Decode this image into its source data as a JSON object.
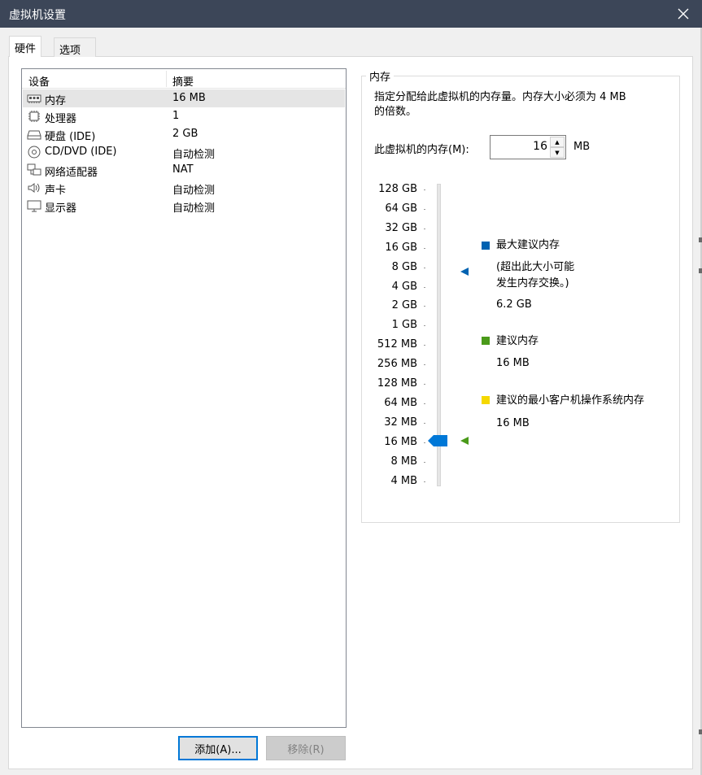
{
  "window": {
    "title": "虚拟机设置"
  },
  "tabs": [
    {
      "label": "硬件"
    },
    {
      "label": "选项"
    }
  ],
  "device_list": {
    "columns": [
      "设备",
      "摘要"
    ],
    "rows": [
      {
        "name": "内存",
        "summary": "16 MB",
        "icon": "memory-icon"
      },
      {
        "name": "处理器",
        "summary": "1",
        "icon": "processor-icon"
      },
      {
        "name": "硬盘 (IDE)",
        "summary": "2 GB",
        "icon": "harddisk-icon"
      },
      {
        "name": "CD/DVD (IDE)",
        "summary": "自动检测",
        "icon": "cd-icon"
      },
      {
        "name": "网络适配器",
        "summary": "NAT",
        "icon": "network-icon"
      },
      {
        "name": "声卡",
        "summary": "自动检测",
        "icon": "speaker-icon"
      },
      {
        "name": "显示器",
        "summary": "自动检测",
        "icon": "monitor-icon"
      }
    ],
    "selected": "内存"
  },
  "buttons": {
    "add": "添加(A)...",
    "remove": "移除(R)"
  },
  "memory": {
    "group_title": "内存",
    "description_line1": "指定分配给此虚拟机的内存量。内存大小必须为 4 MB",
    "description_line2": "的倍数。",
    "field_label": "此虚拟机的内存(M):",
    "value": "16",
    "unit": "MB",
    "scale": [
      "128 GB",
      "64 GB",
      "32 GB",
      "16 GB",
      "8 GB",
      "4 GB",
      "2 GB",
      "1 GB",
      "512 MB",
      "256 MB",
      "128 MB",
      "64 MB",
      "32 MB",
      "16 MB",
      "8 MB",
      "4 MB"
    ],
    "legend": {
      "max": {
        "label": "最大建议内存",
        "note1": "(超出此大小可能",
        "note2": "发生内存交换。)",
        "value": "6.2 GB",
        "color": "#0062b1",
        "marker_level": "8 GB"
      },
      "recommended": {
        "label": "建议内存",
        "value": "16 MB",
        "color": "#4a9a1a",
        "marker_level": "16 MB"
      },
      "min": {
        "label": "建议的最小客户机操作系统内存",
        "value": "16 MB",
        "color": "#f5d800"
      }
    },
    "slider_level": "16 MB"
  }
}
